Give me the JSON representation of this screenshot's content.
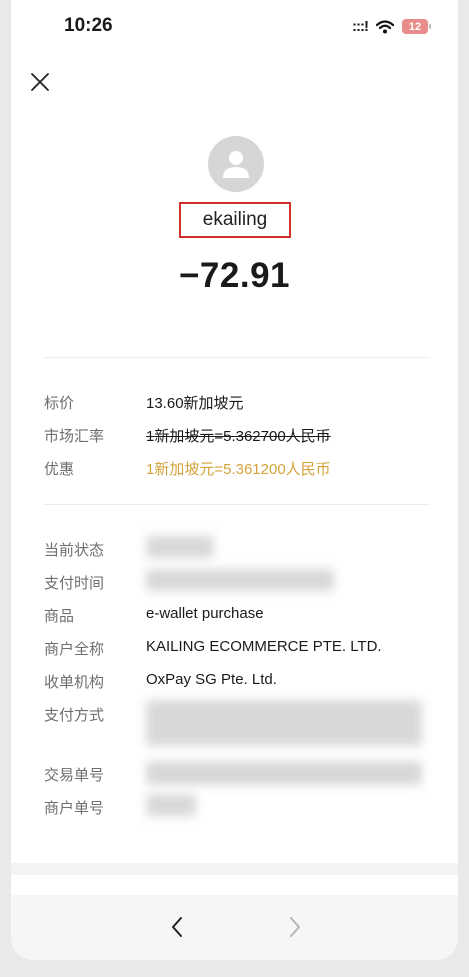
{
  "status_bar": {
    "time": "10:26",
    "signal": ":::!",
    "battery": "12"
  },
  "merchant": {
    "name": "ekailing"
  },
  "amount": "−72.91",
  "pricing": [
    {
      "label": "标价",
      "value": "13.60新加坡元",
      "style": "normal"
    },
    {
      "label": "市场汇率",
      "value": "1新加坡元=5.362700人民币",
      "style": "strike"
    },
    {
      "label": "优惠",
      "value": "1新加坡元=5.361200人民币",
      "style": "promo"
    }
  ],
  "details": [
    {
      "label": "当前状态",
      "value": ""
    },
    {
      "label": "支付时间",
      "value": ""
    },
    {
      "label": "商品",
      "value": "e-wallet purchase"
    },
    {
      "label": "商户全称",
      "value": "KAILING ECOMMERCE PTE. LTD."
    },
    {
      "label": "收单机构",
      "value": "OxPay SG Pte. Ltd."
    },
    {
      "label": "支付方式",
      "value": ""
    },
    {
      "label": "交易单号",
      "value": ""
    },
    {
      "label": "商户单号",
      "value": ""
    }
  ],
  "colors": {
    "promo": "#d4a33b",
    "highlight_border": "#d0322a",
    "battery": "#e88d8a"
  }
}
